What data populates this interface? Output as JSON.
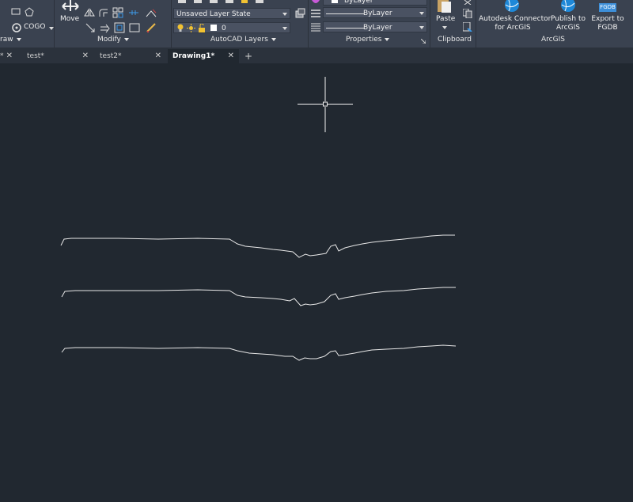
{
  "ribbon": {
    "draw": {
      "panel_title": "raw",
      "cogo_label": "COGO"
    },
    "modify": {
      "move_label": "Move",
      "panel_title": "Modify"
    },
    "layers": {
      "layer_state": "Unsaved Layer State",
      "current_layer": "0",
      "panel_title": "AutoCAD Layers"
    },
    "properties": {
      "top_value": "ByLayer",
      "linetype": "ByLayer",
      "lineweight": "ByLayer",
      "panel_title": "Properties"
    },
    "clipboard": {
      "paste_label": "Paste",
      "panel_title": "Clipboard"
    },
    "arcgis": {
      "connector_label_1": "Autodesk Connector",
      "connector_label_2": "for ArcGIS",
      "publish_label_1": "Publish to",
      "publish_label_2": "ArcGIS",
      "export_label_1": "Export to",
      "export_label_2": "FGDB",
      "fgdb_badge": "FGDB",
      "panel_title": "ArcGIS"
    }
  },
  "tabs": [
    {
      "label": "*"
    },
    {
      "label": "test*"
    },
    {
      "label": "test2*"
    },
    {
      "label": "Drawing1*"
    }
  ],
  "colors": {
    "ribbon_bg": "#3a4250",
    "canvas_bg": "#212830",
    "polyline": "#e8e8e8",
    "arcgis_blue": "#1e88d8"
  }
}
